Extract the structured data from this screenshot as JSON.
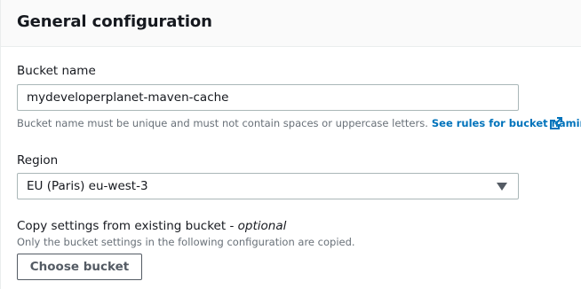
{
  "panel": {
    "title": "General configuration"
  },
  "bucket_name": {
    "label": "Bucket name",
    "value": "mydeveloperplanet-maven-cache",
    "hint": "Bucket name must be unique and must not contain spaces or uppercase letters.",
    "link_text": "See rules for bucket naming",
    "link_icon": "external-link-icon"
  },
  "region": {
    "label": "Region",
    "selected": "EU (Paris) eu-west-3",
    "caret_icon": "caret-down-icon"
  },
  "copy_settings": {
    "label": "Copy settings from existing bucket - ",
    "label_optional": "optional",
    "hint": "Only the bucket settings in the following configuration are copied.",
    "button_label": "Choose bucket"
  },
  "colors": {
    "link": "#0073bb",
    "border": "#aab7b8",
    "header_bg": "#fafafa",
    "button_text": "#545b64"
  }
}
